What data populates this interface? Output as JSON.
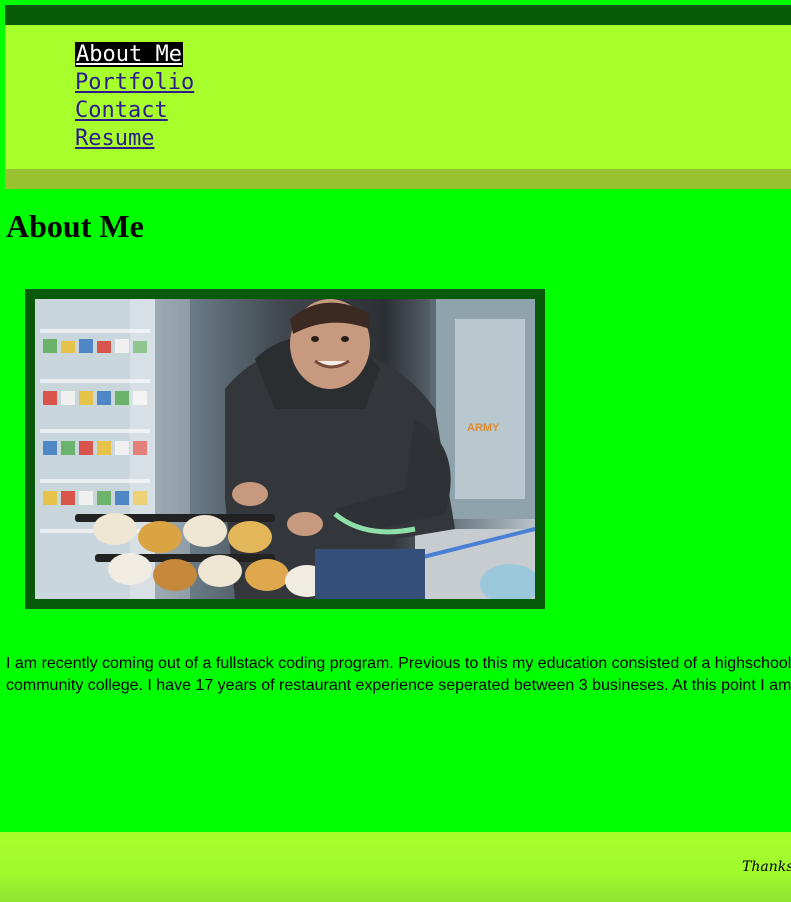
{
  "nav": {
    "items": [
      {
        "label": "About Me",
        "active": true
      },
      {
        "label": "Portfolio",
        "active": false
      },
      {
        "label": "Contact",
        "active": false
      },
      {
        "label": "Resume",
        "active": false
      }
    ]
  },
  "main": {
    "title": "About Me",
    "intro_line1": "I am recently coming out of a fullstack coding program. Previous to this my education consisted of a highschool d",
    "intro_line2": "community college. I have 17 years of restaurant experience seperated between 3 busineses. At this point I am h"
  },
  "footer": {
    "text": "Thanks"
  },
  "colors": {
    "page_bg": "#00ff00",
    "nav_bg": "#a7ff2b",
    "frame": "#075a07"
  }
}
